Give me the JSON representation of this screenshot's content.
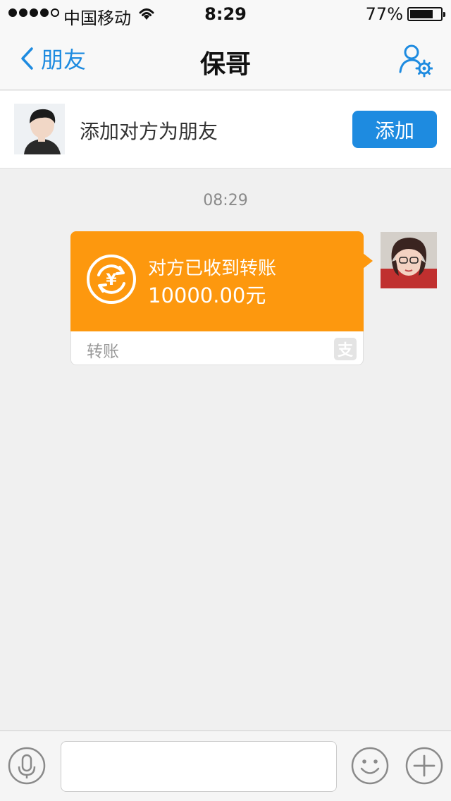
{
  "status_bar": {
    "carrier": "中国移动",
    "time": "8:29",
    "battery_percent": "77%",
    "battery_level": 0.77,
    "signal_bars_filled": 4,
    "signal_bars_total": 5
  },
  "nav": {
    "back_label": "朋友",
    "title": "保哥",
    "settings_icon": "contact-settings-icon"
  },
  "add_banner": {
    "text": "添加对方为朋友",
    "button_label": "添加"
  },
  "chat": {
    "timestamp": "08:29",
    "messages": [
      {
        "type": "transfer",
        "status_text": "对方已收到转账",
        "amount": "10000.00元",
        "footer_label": "转账",
        "footer_icon_glyph": "支",
        "icon": "yuan-exchange-icon"
      }
    ]
  },
  "input_bar": {
    "input_value": "",
    "input_placeholder": "",
    "icons": [
      "microphone-icon",
      "emoji-icon",
      "plus-icon"
    ]
  },
  "colors": {
    "accent": "#1e8be0",
    "transfer_orange": "#fd980e",
    "background": "#f0f0f0"
  }
}
